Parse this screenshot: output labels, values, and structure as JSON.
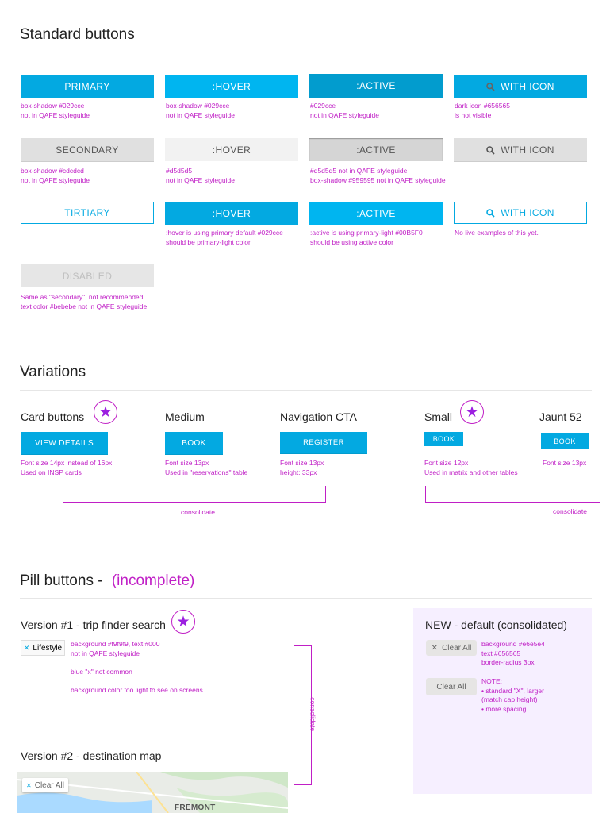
{
  "standard": {
    "title": "Standard buttons",
    "row1": {
      "primary": "PRIMARY",
      "hover": ":HOVER",
      "active": ":ACTIVE",
      "with_icon": "WITH ICON",
      "note_primary": [
        "box-shadow #029cce",
        "not in QAFE styleguide"
      ],
      "note_hover": [
        "box-shadow #029cce",
        "not in QAFE styleguide"
      ],
      "note_active": [
        "#029cce",
        "not in QAFE styleguide"
      ],
      "note_icon": [
        "dark icon #656565",
        "is not visible"
      ]
    },
    "row2": {
      "secondary": "SECONDARY",
      "hover": ":HOVER",
      "active": ":ACTIVE",
      "with_icon": "WITH ICON",
      "note_secondary": [
        "box-shadow #cdcdcd",
        "not in QAFE styleguide"
      ],
      "note_hover": [
        "#d5d5d5",
        "not in QAFE styleguide"
      ],
      "note_active": [
        "#d5d5d5 not in QAFE styleguide",
        "box-shadow #959595 not in QAFE styleguide"
      ]
    },
    "row3": {
      "tertiary": "TIRTIARY",
      "hover": ":HOVER",
      "active": ":ACTIVE",
      "with_icon": "WITH ICON",
      "note_hover": [
        ":hover is using primary default #029cce",
        "should be primary-light color"
      ],
      "note_active": [
        ":active is using primary-light #00B5F0",
        "should be using active color"
      ],
      "note_icon": [
        "No live examples of this yet."
      ]
    },
    "row4": {
      "disabled": "DISABLED",
      "note": [
        "Same as \"secondary\", not recommended.",
        "text color #bebebe not in QAFE styleguide"
      ]
    }
  },
  "variations": {
    "title": "Variations",
    "card": {
      "heading": "Card buttons",
      "button": "VIEW DETAILS",
      "note": [
        "Font size 14px instead of 16px.",
        "Used on INSP cards"
      ]
    },
    "medium": {
      "heading": "Medium",
      "button": "BOOK",
      "note": [
        "Font size 13px",
        "Used in \"reservations\" table"
      ]
    },
    "nav": {
      "heading": "Navigation CTA",
      "button": "REGISTER",
      "note": [
        "Font size 13px",
        "height: 33px"
      ]
    },
    "small": {
      "heading": "Small",
      "button": "BOOK",
      "note": [
        "Font size 12px",
        "Used in matrix and other tables"
      ]
    },
    "jaunt": {
      "heading": "Jaunt 52",
      "button": "BOOK",
      "note": [
        "Font size 13px"
      ]
    },
    "consolidate_1": "consolidate",
    "consolidate_2": "consolidate"
  },
  "pills": {
    "title": "Pill buttons -",
    "title_flag": "(incomplete)",
    "v1": {
      "heading": "Version #1 - trip finder search",
      "pill_label": "Lifestyle",
      "note_a": [
        "background #f9f9f9, text #000",
        "not in QAFE styleguide"
      ],
      "note_b": "blue \"x\" not common",
      "note_c": "background color too light to see on screens"
    },
    "v2": {
      "heading": "Version #2 - destination map",
      "pill_label": "Clear All",
      "map_label": "FREMONT"
    },
    "consolidate": "consolidate",
    "new": {
      "heading": "NEW - default (consolidated)",
      "pill1": "Clear All",
      "pill2": "Clear All",
      "note1": [
        "background #e6e5e4",
        "text #656565",
        "border-radius 3px"
      ],
      "note2": [
        "NOTE:",
        "• standard \"X\", larger",
        "(match cap height)",
        "• more spacing"
      ]
    }
  },
  "colors": {
    "primary": "#03a9e1",
    "annotation": "#c01fc6",
    "star": "#9b1fe0"
  }
}
